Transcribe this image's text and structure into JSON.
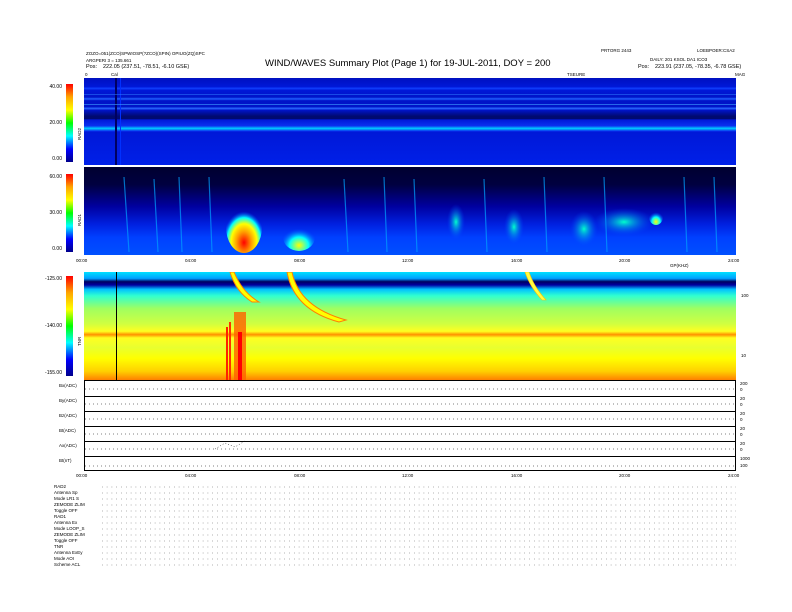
{
  "header": {
    "title": "WIND/WAVES Summary Plot (Page 1) for 19-JUL-2011, DOY = 200",
    "left_line1": "ZOZO=051(ZCO)SPWIOSP(?ZCO)(SPIN) OPIUO(ZQ)SPC",
    "left_line2": "ARGPERI 3 = 135.661",
    "left_pos_label": "Pos:",
    "left_pos_value": "222.05 (237.51, -78.51, -6.10 GSE)",
    "right_top_mid": "PRTORG 2443",
    "right_top_right": "LOEBPOER:CSA2",
    "right_line2": "DAILY: 201 KSOL DA1 ICO3",
    "right_pos_label": "Pos:",
    "right_pos_value": "223.91 (237.05, -78.35, -6.78 GSE)",
    "small_left_a": "0",
    "small_left_b": "Cal",
    "small_right_mid": "TSEURE",
    "small_right_end": "MAG"
  },
  "panels": {
    "rad2": {
      "label": "RAD2",
      "ticks": [
        "40.00",
        "20.00",
        "0.00"
      ]
    },
    "rad1": {
      "label": "RAD1",
      "ticks": [
        "60.00",
        "30.00",
        "0.00"
      ]
    },
    "tnr": {
      "label": "TNR",
      "ticks": [
        "-125.00",
        "-140.00",
        "-155.00"
      ],
      "right_ticks": [
        "100",
        "10"
      ],
      "right_title": "GP(KHZ)"
    },
    "time_axis_top": [
      "00:00",
      "04:00",
      "08:00",
      "12:00",
      "16:00",
      "20:00",
      "24:00"
    ],
    "time_axis_bottom": [
      "00:00",
      "04:00",
      "08:00",
      "12:00",
      "16:00",
      "20:00",
      "24:00"
    ]
  },
  "line_panels": [
    {
      "label": "Bx(ADC)",
      "right": [
        "200",
        "0",
        "-20"
      ]
    },
    {
      "label": "By(ADC)",
      "right": [
        "20",
        "0",
        "-20"
      ]
    },
    {
      "label": "Bz(ADC)",
      "right": [
        "20",
        "0",
        "-20"
      ]
    },
    {
      "label": "Bt(ADC)",
      "right": [
        "20",
        "0",
        "-20"
      ]
    },
    {
      "label": "Ax(ADC)",
      "right": [
        "20",
        "0",
        "-20"
      ]
    },
    {
      "label": "Bt(nT)",
      "right": [
        "1000",
        "100",
        "10"
      ]
    }
  ],
  "bottom_table": {
    "rad2": [
      "RAD2",
      "Antenna   Sp",
      "Mode   LR1 S",
      "ZEMODE  ZLIM",
      "Toggle    OFF"
    ],
    "rad1": [
      "RAD1",
      "Antenna   Ex",
      "Mode   LOOP_S",
      "ZEMODE ZLIM",
      "Toggle    OFF"
    ],
    "tnr": [
      "TNR",
      "Antenna  ExEy",
      "Mode    AOI",
      "Scheme    ACL"
    ]
  },
  "chart_data": [
    {
      "type": "heatmap",
      "title": "RAD2",
      "xlim": [
        0,
        24
      ],
      "ylim": [
        0,
        40
      ],
      "colormap": [
        "#00008b",
        "#0000ff",
        "#00bfff",
        "#00ff7f",
        "#ffff00",
        "#ff7f00",
        "#ff0000"
      ],
      "background_level": "blue (low intensity)",
      "features": [
        {
          "type": "horizontal_band",
          "y": 25,
          "color": "#00bfff"
        },
        {
          "type": "horizontal_band",
          "y": 17,
          "color": "#00ffff"
        },
        {
          "type": "vertical_line",
          "x": 1.25,
          "note": "Cal"
        }
      ]
    },
    {
      "type": "heatmap",
      "title": "RAD1",
      "xlim": [
        0,
        24
      ],
      "ylim": [
        0,
        60
      ],
      "features": [
        {
          "type": "type_iii_burst",
          "x": 5.3,
          "peak": "red"
        },
        {
          "type": "type_iii_burst",
          "x": 7.0,
          "peak": "yellow"
        },
        {
          "type": "bursts_cluster",
          "x_range": [
            12,
            24
          ],
          "peak": "cyan"
        },
        {
          "type": "burst",
          "x": 19.8,
          "peak": "yellow"
        }
      ]
    },
    {
      "type": "heatmap",
      "title": "TNR",
      "xlim": [
        0,
        24
      ],
      "zlim": [
        -155,
        -125
      ],
      "features": [
        {
          "type": "type_iii_burst",
          "x": 5.3,
          "peak": "red"
        },
        {
          "type": "type_iii_burst",
          "x": 7.0,
          "peak": "yellow"
        },
        {
          "type": "plasma_line",
          "level": "red",
          "y_fraction": 0.55
        }
      ]
    }
  ],
  "colors": {
    "dark_blue": "#00008b",
    "blue": "#0000ff",
    "cyan": "#00ffff",
    "yellow": "#ffff00",
    "red": "#ff0000"
  }
}
